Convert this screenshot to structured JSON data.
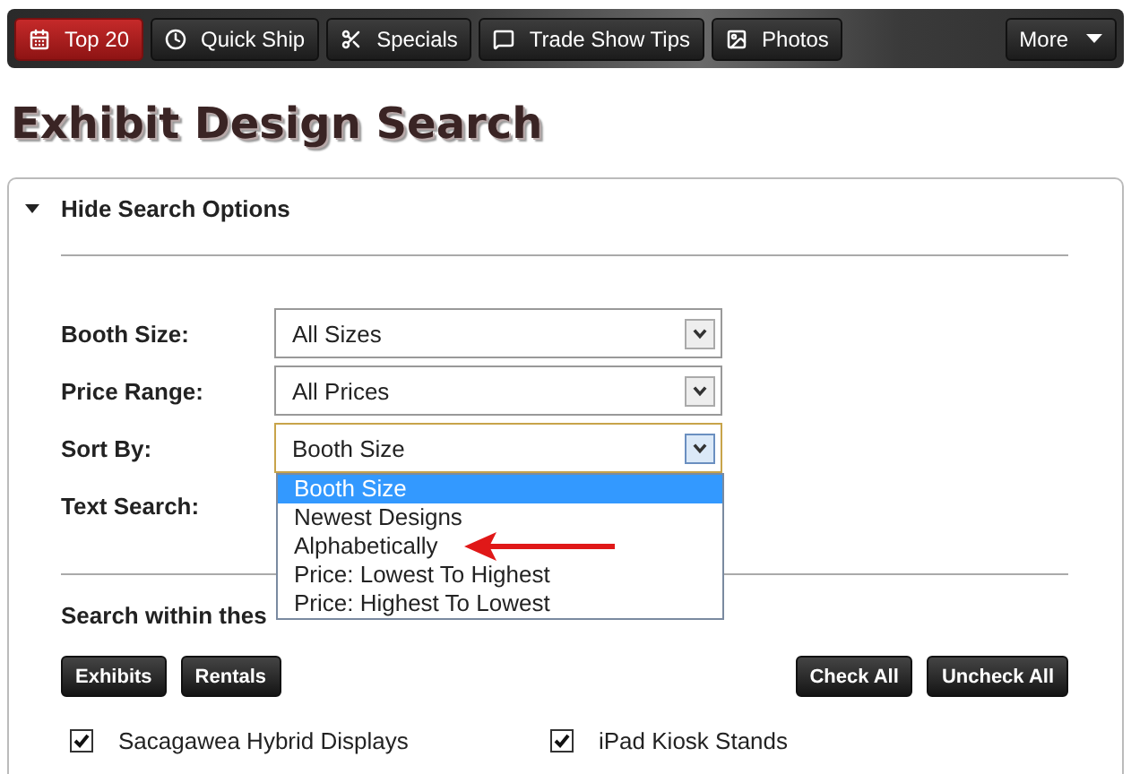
{
  "nav": {
    "items": [
      {
        "label": "Top 20",
        "selected": true
      },
      {
        "label": "Quick Ship",
        "selected": false
      },
      {
        "label": "Specials",
        "selected": false
      },
      {
        "label": "Trade Show Tips",
        "selected": false
      },
      {
        "label": "Photos",
        "selected": false
      }
    ],
    "more": "More"
  },
  "title": "Exhibit Design Search",
  "panel": {
    "toggle": {
      "label": "Hide Search Options",
      "expanded": true
    },
    "fields": [
      {
        "label": "Booth Size:",
        "kind": "select",
        "value": "All Sizes",
        "focused": false
      },
      {
        "label": "Price Range:",
        "kind": "select",
        "value": "All Prices",
        "focused": false
      },
      {
        "label": "Sort By:",
        "kind": "select",
        "value": "Booth Size",
        "focused": true
      },
      {
        "label": "Text Search:",
        "kind": "text"
      }
    ],
    "dropdown": {
      "options": [
        {
          "label": "Booth Size",
          "selected": true
        },
        {
          "label": "Newest Designs",
          "selected": false
        },
        {
          "label": "Alphabetically",
          "selected": false
        },
        {
          "label": "Price: Lowest To Highest",
          "selected": false
        },
        {
          "label": "Price: Highest To Lowest",
          "selected": false
        }
      ]
    },
    "galleries": {
      "heading": "Search within thes",
      "filters": [
        "Exhibits",
        "Rentals"
      ],
      "actions": [
        "Check All",
        "Uncheck All"
      ],
      "items": [
        {
          "label": "Sacagawea Hybrid Displays",
          "checked": true
        },
        {
          "label": "iPad Kiosk Stands",
          "checked": true
        }
      ]
    }
  }
}
